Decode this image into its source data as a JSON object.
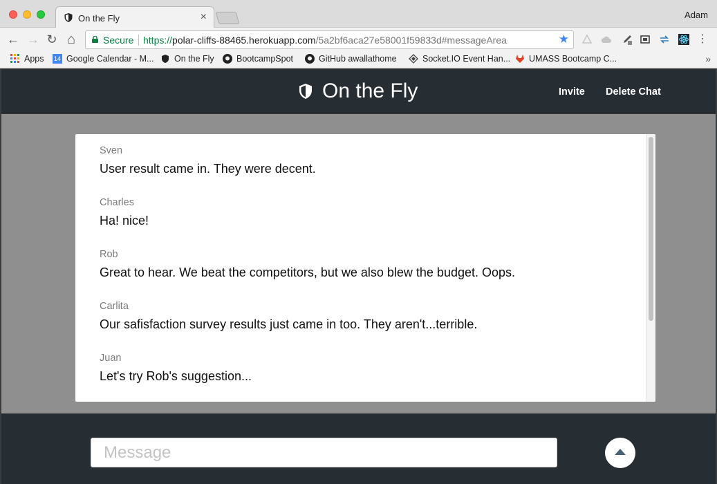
{
  "browser": {
    "tab_title": "On the Fly",
    "tab_close": "×",
    "profile_name": "Adam",
    "secure_label": "Secure",
    "url": {
      "scheme": "https://",
      "host": "polar-cliffs-88465.herokuapp.com",
      "path": "/5a2bf6aca27e58001f59833d#messageArea"
    },
    "nav": {
      "back": "←",
      "forward": "→",
      "reload": "↻",
      "home": "⌂"
    },
    "bookmark_star": "★",
    "menu_glyph": "⋮",
    "bookmarks": [
      {
        "label": "Apps",
        "icon": "apps-grid-icon"
      },
      {
        "label": "Google Calendar - M...",
        "icon": "calendar-icon",
        "badge": "14"
      },
      {
        "label": "On the Fly",
        "icon": "shield-icon"
      },
      {
        "label": "BootcampSpot",
        "icon": "github-icon"
      },
      {
        "label": "GitHub awallathome",
        "icon": "github-icon"
      },
      {
        "label": "Socket.IO Event Han...",
        "icon": "socketio-icon"
      },
      {
        "label": "UMASS Bootcamp C...",
        "icon": "gitlab-icon"
      }
    ],
    "bookmarks_more": "»"
  },
  "app": {
    "title": "On the Fly",
    "nav": {
      "invite": "Invite",
      "delete_chat": "Delete Chat"
    }
  },
  "messages": [
    {
      "author": "Sven",
      "text": "User result came in. They were decent."
    },
    {
      "author": "Charles",
      "text": "Ha! nice!"
    },
    {
      "author": "Rob",
      "text": "Great to hear. We beat the competitors, but we also blew the budget. Oops."
    },
    {
      "author": "Carlita",
      "text": "Our safisfaction survey results just came in too. They aren't...terrible."
    },
    {
      "author": "Juan",
      "text": "Let's try Rob's suggestion..."
    }
  ],
  "composer": {
    "placeholder": "Message",
    "value": ""
  },
  "colors": {
    "appbar": "#262d33",
    "content_bg": "#8f8f8f",
    "author_text": "#7b7b7b",
    "secure_green": "#0b8043",
    "send_arrow": "#4a6276"
  }
}
